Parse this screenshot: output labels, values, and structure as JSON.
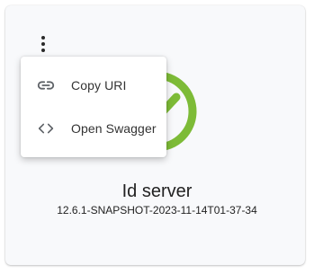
{
  "card": {
    "title": "Id server",
    "version": "12.6.1-SNAPSHOT-2023-11-14T01-37-34",
    "status_color": "#7dbb37",
    "status_icon": "check-circle-icon"
  },
  "menu": {
    "items": [
      {
        "label": "Copy URI",
        "icon": "link-icon"
      },
      {
        "label": "Open Swagger",
        "icon": "code-icon"
      }
    ]
  },
  "colors": {
    "card_background": "#f8f9fb",
    "menu_background": "#ffffff",
    "text": "#222222",
    "icon": "#5f6368"
  }
}
